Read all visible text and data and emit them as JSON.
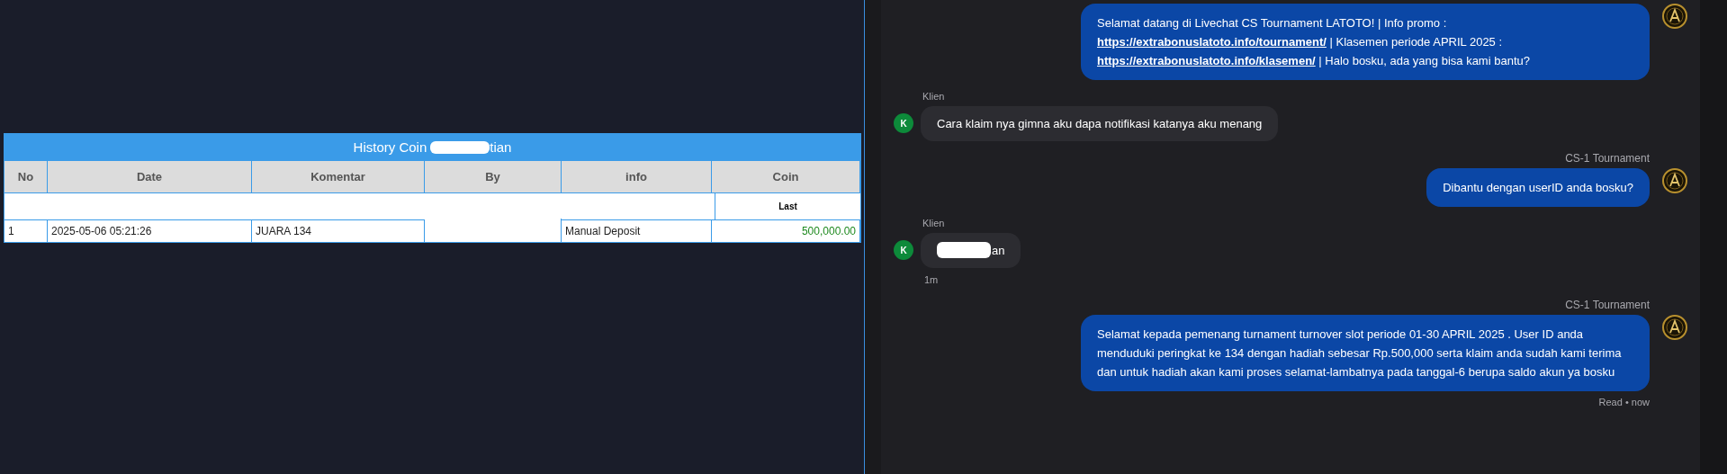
{
  "history": {
    "title": "History Coin",
    "title_tail": "tian",
    "columns": [
      "No",
      "Date",
      "Komentar",
      "By",
      "info",
      "Coin"
    ],
    "subheader": "Last",
    "rows": [
      {
        "no": "1",
        "date": "2025-05-06 05:21:26",
        "komentar": "JUARA 134",
        "by": "",
        "info": "Manual Deposit",
        "coin": "500,000.00"
      }
    ]
  },
  "chat": {
    "messages": [
      {
        "kind": "agent",
        "parts": [
          {
            "kind": "text",
            "text": "Selamat datang di Livechat CS Tournament LATOTO! | Info promo : "
          },
          {
            "kind": "link",
            "text": "https://extrabonuslatoto.info/tournament/"
          },
          {
            "kind": "text",
            "text": " | Klasemen periode APRIL 2025 : "
          },
          {
            "kind": "link",
            "text": "https://extrabonuslatoto.info/klasemen/"
          },
          {
            "kind": "text",
            "text": " | Halo bosku, ada yang bisa kami bantu?"
          }
        ]
      },
      {
        "kind": "client",
        "sender": "Klien",
        "avatar": "K",
        "parts": [
          {
            "kind": "text",
            "text": "Cara klaim nya gimna aku dapa notifikasi katanya aku menang"
          }
        ]
      },
      {
        "kind": "agent",
        "sender": "CS-1 Tournament",
        "parts": [
          {
            "kind": "text",
            "text": "Dibantu dengan userID anda bosku?"
          }
        ]
      },
      {
        "kind": "client",
        "sender": "Klien",
        "avatar": "K",
        "redacted": true,
        "parts": [
          {
            "kind": "text",
            "text": "an"
          }
        ],
        "time": "1m"
      },
      {
        "kind": "agent",
        "sender": "CS-1 Tournament",
        "parts": [
          {
            "kind": "text",
            "text": "Selamat kepada pemenang turnament turnover slot periode 01-30 APRIL 2025 . User ID anda menduduki peringkat ke 134 dengan hadiah sebesar Rp.500,000 serta klaim anda sudah kami terima dan untuk hadiah akan kami proses selamat-lambatnya pada tanggal-6 berupa saldo akun ya bosku"
          }
        ],
        "status": "Read • now"
      }
    ]
  }
}
